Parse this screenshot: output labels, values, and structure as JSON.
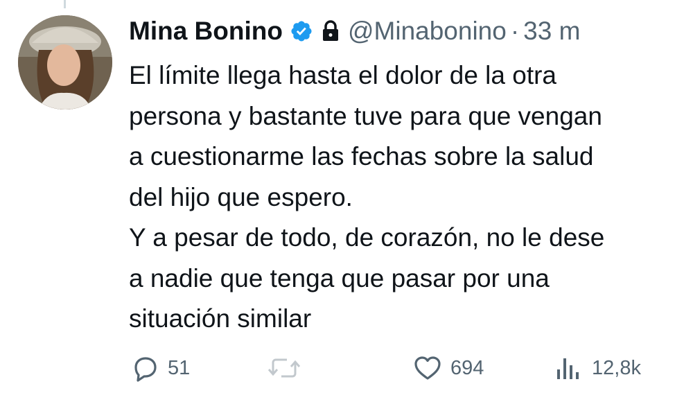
{
  "author": {
    "display_name": "Mina Bonino",
    "handle": "@Minabonino",
    "separator": "·",
    "timestamp": "33 m",
    "verified_icon": "verified-badge-icon",
    "protected_icon": "lock-icon"
  },
  "tweet": {
    "lines": [
      "El límite llega hasta el dolor de la otra",
      "persona y bastante tuve para que vengan",
      "a cuestionarme las fechas sobre la salud",
      "del hijo que espero.",
      "Y a pesar de todo, de corazón, no le dese",
      "a nadie que tenga que pasar por una",
      "situación similar"
    ]
  },
  "actions": {
    "replies": "51",
    "retweets": "",
    "likes": "694",
    "views": "12,8k"
  },
  "colors": {
    "text": "#0f1419",
    "muted": "#536471",
    "verified": "#1d9bf0"
  }
}
